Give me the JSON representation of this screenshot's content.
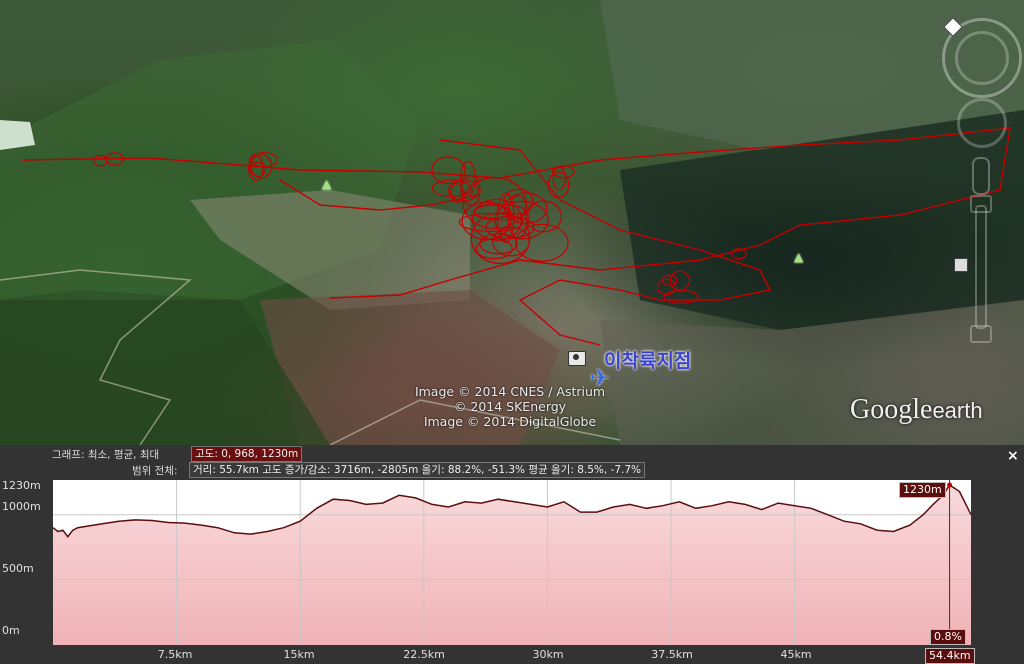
{
  "map": {
    "landing_label": "이착륙지점",
    "credits": [
      "Image © 2014 CNES / Astrium",
      "© 2014 SKEnergy",
      "Image © 2014 DigitalGlobe"
    ],
    "logo_main": "Google",
    "logo_sub": "earth",
    "track_color": "#c40000"
  },
  "profile": {
    "graph_label": "그래프: 최소, 평균, 최대",
    "graph_values": "고도: 0, 968, 1230m",
    "range_label": "범위 전체:",
    "range_stats": "거리: 55.7km 고도 증가/감소: 3716m, -2805m 올기: 88.2%, -51.3% 평균 올기: 8.5%, -7.7%",
    "close": "×",
    "y_ticks": [
      "1230m",
      "1000m",
      "500m",
      "0m"
    ],
    "x_ticks": [
      "7.5km",
      "15km",
      "22.5km",
      "30km",
      "37.5km",
      "45km",
      "54.4km"
    ],
    "cursor_elevation": "1230m",
    "cursor_slope": "0.8%",
    "cursor_distance": "54.4km"
  },
  "chart_data": {
    "type": "area",
    "xlabel": "",
    "ylabel": "",
    "xlim": [
      0,
      55.7
    ],
    "ylim": [
      0,
      1230
    ],
    "x": [
      0,
      0.3,
      0.6,
      0.9,
      1.2,
      1.5,
      2.0,
      3.0,
      4.0,
      5.0,
      6.0,
      7.0,
      8.0,
      9.0,
      10.0,
      11.0,
      12.0,
      13.0,
      14.0,
      15.0,
      16.0,
      17.0,
      18.0,
      19.0,
      20.0,
      21.0,
      22.0,
      23.0,
      24.0,
      25.0,
      26.0,
      27.0,
      28.0,
      29.0,
      30.0,
      31.0,
      32.0,
      33.0,
      34.0,
      35.0,
      36.0,
      37.0,
      38.0,
      39.0,
      40.0,
      41.0,
      42.0,
      43.0,
      44.0,
      45.0,
      46.0,
      47.0,
      48.0,
      49.0,
      50.0,
      51.0,
      52.0,
      52.8,
      53.4,
      54.0,
      54.4,
      55.0,
      55.7
    ],
    "values": [
      900,
      870,
      880,
      830,
      880,
      900,
      910,
      930,
      950,
      960,
      955,
      940,
      935,
      920,
      900,
      860,
      850,
      870,
      900,
      950,
      1050,
      1120,
      1110,
      1080,
      1090,
      1150,
      1130,
      1080,
      1060,
      1100,
      1090,
      1120,
      1100,
      1080,
      1060,
      1100,
      1020,
      1020,
      1060,
      1080,
      1050,
      1070,
      1100,
      1050,
      1070,
      1100,
      1080,
      1040,
      1090,
      1070,
      1050,
      1000,
      950,
      930,
      880,
      870,
      920,
      1000,
      1080,
      1150,
      1230,
      1180,
      1000
    ],
    "color": "#5a0e0e",
    "fill": "#f6c9cc"
  }
}
